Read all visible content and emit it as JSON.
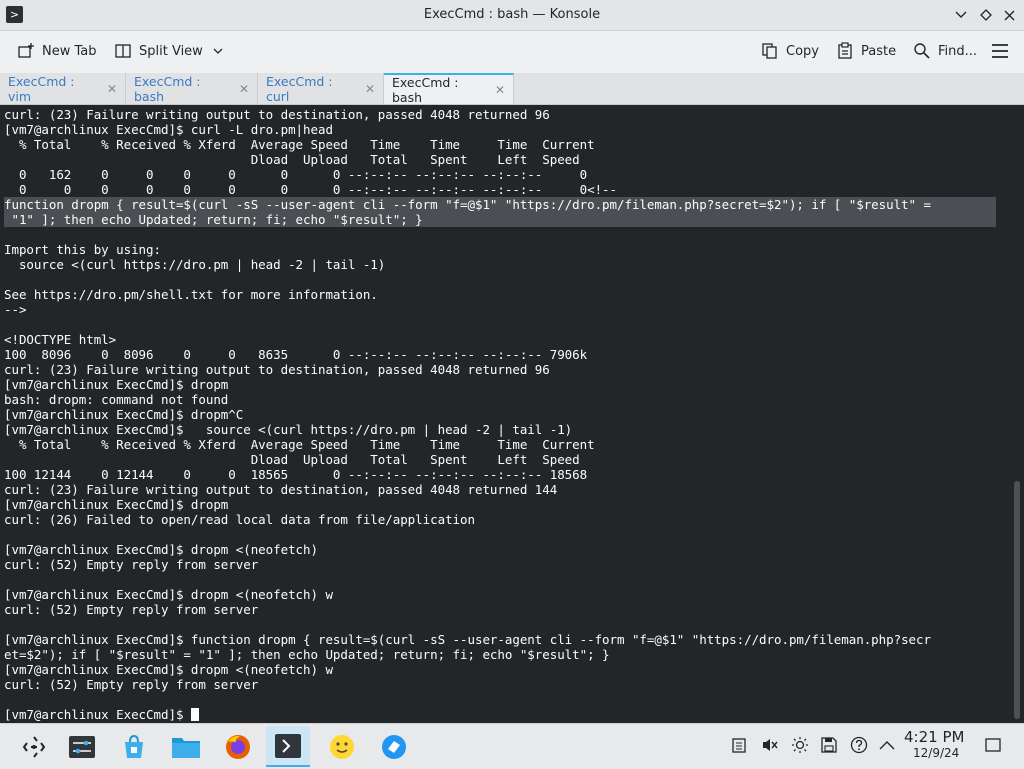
{
  "window": {
    "title": "ExecCmd : bash — Konsole",
    "app_icon": "konsole-icon",
    "controls": [
      "minimize-icon",
      "maximize-icon",
      "close-icon"
    ]
  },
  "toolbar": {
    "new_tab": "New Tab",
    "split_view": "Split View",
    "copy": "Copy",
    "paste": "Paste",
    "find": "Find..."
  },
  "tabs": [
    {
      "label": "ExecCmd : vim",
      "active": false
    },
    {
      "label": "ExecCmd : bash",
      "active": false
    },
    {
      "label": "ExecCmd : curl",
      "active": false
    },
    {
      "label": "ExecCmd : bash",
      "active": true
    }
  ],
  "terminal": {
    "lines": [
      "curl: (23) Failure writing output to destination, passed 4048 returned 96",
      "[vm7@archlinux ExecCmd]$ curl -L dro.pm|head",
      "  % Total    % Received % Xferd  Average Speed   Time    Time     Time  Current",
      "                                 Dload  Upload   Total   Spent    Left  Speed",
      "  0   162    0     0    0     0      0      0 --:--:-- --:--:-- --:--:--     0",
      "  0     0    0     0    0     0      0      0 --:--:-- --:--:-- --:--:--     0<!--",
      "function dropm { result=$(curl -sS --user-agent cli --form \"f=@$1\" \"https://dro.pm/fileman.php?secret=$2\"); if [ \"$result\" =",
      " \"1\" ]; then echo Updated; return; fi; echo \"$result\"; }",
      "",
      "Import this by using:",
      "  source <(curl https://dro.pm | head -2 | tail -1)",
      "",
      "See https://dro.pm/shell.txt for more information.",
      "-->",
      "",
      "<!DOCTYPE html>",
      "100  8096    0  8096    0     0   8635      0 --:--:-- --:--:-- --:--:-- 7906k",
      "curl: (23) Failure writing output to destination, passed 4048 returned 96",
      "[vm7@archlinux ExecCmd]$ dropm",
      "bash: dropm: command not found",
      "[vm7@archlinux ExecCmd]$ dropm^C",
      "[vm7@archlinux ExecCmd]$   source <(curl https://dro.pm | head -2 | tail -1)",
      "  % Total    % Received % Xferd  Average Speed   Time    Time     Time  Current",
      "                                 Dload  Upload   Total   Spent    Left  Speed",
      "100 12144    0 12144    0     0  18565      0 --:--:-- --:--:-- --:--:-- 18568",
      "curl: (23) Failure writing output to destination, passed 4048 returned 144",
      "[vm7@archlinux ExecCmd]$ dropm",
      "curl: (26) Failed to open/read local data from file/application",
      "",
      "[vm7@archlinux ExecCmd]$ dropm <(neofetch)",
      "curl: (52) Empty reply from server",
      "",
      "[vm7@archlinux ExecCmd]$ dropm <(neofetch) w",
      "curl: (52) Empty reply from server",
      "",
      "[vm7@archlinux ExecCmd]$ function dropm { result=$(curl -sS --user-agent cli --form \"f=@$1\" \"https://dro.pm/fileman.php?secr",
      "et=$2\"); if [ \"$result\" = \"1\" ]; then echo Updated; return; fi; echo \"$result\"; }",
      "[vm7@archlinux ExecCmd]$ dropm <(neofetch) w",
      "curl: (52) Empty reply from server",
      "",
      "[vm7@archlinux ExecCmd]$ "
    ],
    "selected_lines": [
      6,
      7
    ]
  },
  "taskbar": {
    "apps": [
      "app-launcher-icon",
      "system-settings-icon",
      "discover-store-icon",
      "file-manager-icon",
      "firefox-icon",
      "konsole-icon",
      "emoji-icon",
      "network-tool-icon"
    ],
    "active_app": "konsole-icon",
    "tray": [
      "clipboard-icon",
      "volume-muted-icon",
      "brightness-icon",
      "storage-icon",
      "help-icon",
      "show-hidden-icon"
    ],
    "time": "4:21 PM",
    "date": "12/9/24"
  },
  "colors": {
    "terminal_bg": "#232629",
    "terminal_fg": "#fcfcfc",
    "selection": "#4b4f53",
    "accent": "#3daee9",
    "tab_text": "#3b79c4"
  }
}
